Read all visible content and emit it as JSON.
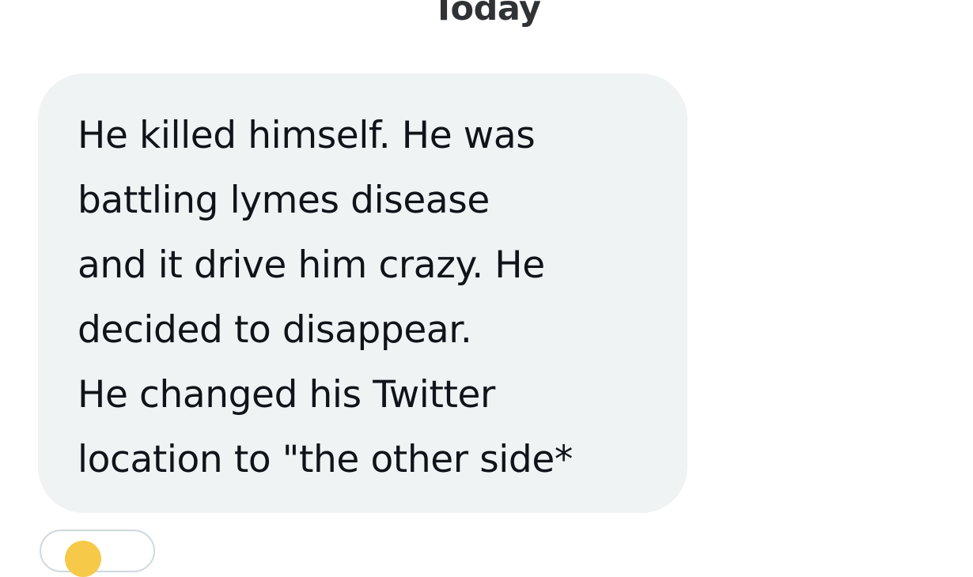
{
  "conversation": {
    "date_divider": "Today",
    "messages": [
      {
        "text": "He killed himself. He was\nbattling lymes disease\nand it drive him crazy. He\ndecided to disappear.\nHe changed his Twitter\nlocation to \"the other side*",
        "reaction": {
          "icon": "emoji-reaction-icon",
          "color": "#f7c948"
        }
      }
    ]
  },
  "colors": {
    "bubble_background": "#eff3f4",
    "text": "#0f1419",
    "divider_text": "#2f3336",
    "reaction_border": "#cfd9de"
  }
}
